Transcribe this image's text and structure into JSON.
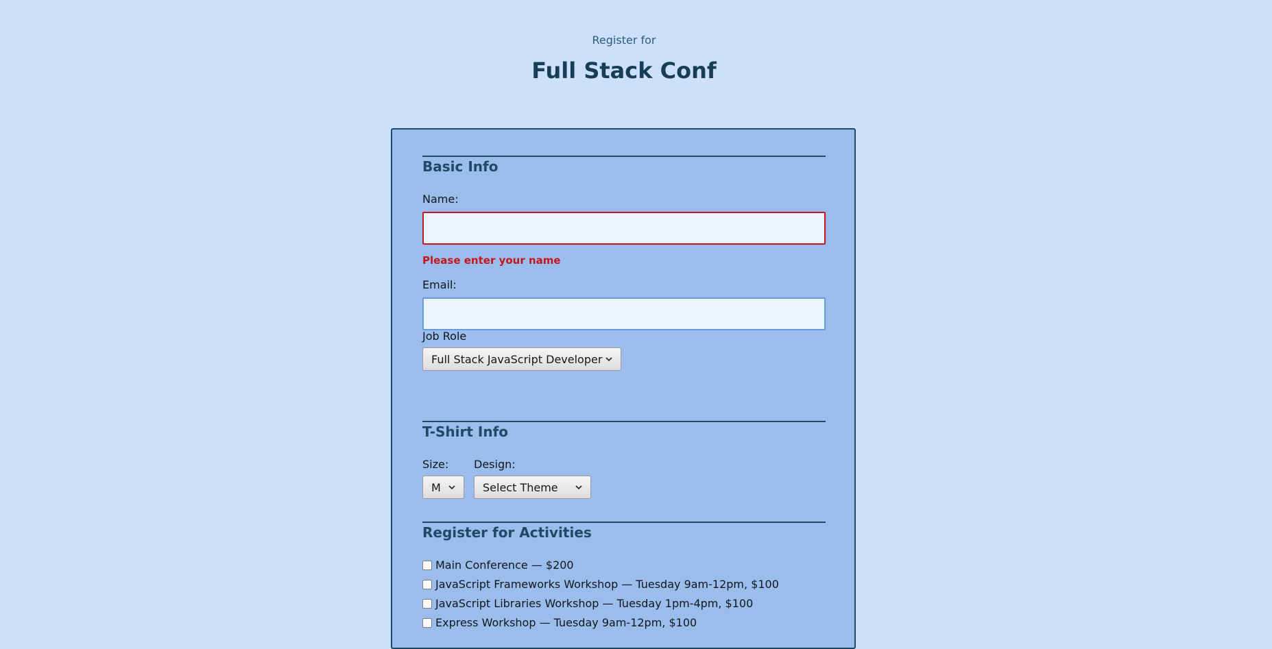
{
  "header": {
    "subtitle": "Register for",
    "title": "Full Stack Conf"
  },
  "basic_info": {
    "section_title": "Basic Info",
    "name_label": "Name:",
    "name_value": "",
    "name_error": "Please enter your name",
    "email_label": "Email:",
    "email_value": "",
    "job_role_label": "Job Role",
    "job_role_selected": "Full Stack JavaScript Developer"
  },
  "tshirt_info": {
    "section_title": "T-Shirt Info",
    "size_label": "Size:",
    "size_selected": "M",
    "design_label": "Design:",
    "design_selected": "Select Theme"
  },
  "activities": {
    "section_title": "Register for Activities",
    "items": [
      {
        "label": "Main Conference — $200",
        "checked": false
      },
      {
        "label": "JavaScript Frameworks Workshop — Tuesday 9am-12pm, $100",
        "checked": false
      },
      {
        "label": "JavaScript Libraries Workshop — Tuesday 1pm-4pm, $100",
        "checked": false
      },
      {
        "label": "Express Workshop — Tuesday 9am-12pm, $100",
        "checked": false
      }
    ]
  },
  "colors": {
    "page_background": "#cde0fa",
    "card_background": "#9bbdec",
    "accent": "#1f4a67",
    "error": "#c4161c"
  }
}
